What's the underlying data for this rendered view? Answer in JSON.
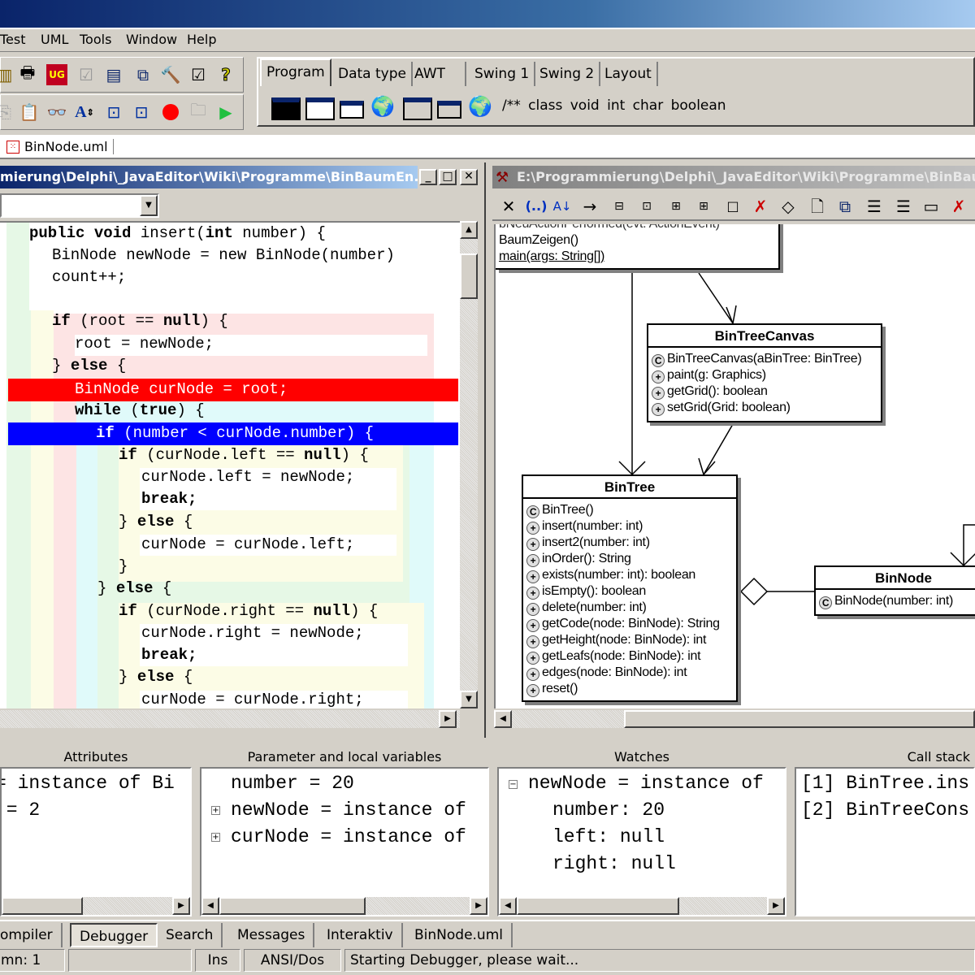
{
  "menu": [
    "Test",
    "UML",
    "Tools",
    "Window",
    "Help"
  ],
  "palette": {
    "tabs": [
      "Program",
      "Data type",
      "AWT",
      "Swing 1",
      "Swing 2",
      "Layout"
    ],
    "active_tab": "Program",
    "keywords": "/** class  void  int  char  boolean"
  },
  "file_tab": "BinNode.uml",
  "editor": {
    "title": "mierung\\Delphi\\_JavaEditor\\Wiki\\Programme\\BinBaumEn...",
    "lines": [
      {
        "text": "public void insert(int number) {"
      },
      {
        "text": "BinNode newNode = new BinNode(number)"
      },
      {
        "text": "count++;"
      },
      {
        "text": ""
      },
      {
        "text": "if (root == null) {"
      },
      {
        "text": "root = newNode;"
      },
      {
        "text": "} else {"
      },
      {
        "text": "BinNode curNode = root;"
      },
      {
        "text": "while (true) {"
      },
      {
        "text": "if (number < curNode.number) {"
      },
      {
        "text": "if (curNode.left == null) {"
      },
      {
        "text": "curNode.left = newNode;"
      },
      {
        "text": "break;"
      },
      {
        "text": "} else {"
      },
      {
        "text": "curNode = curNode.left;"
      },
      {
        "text": "}"
      },
      {
        "text": "} else {"
      },
      {
        "text": "if (curNode.right == null) {"
      },
      {
        "text": "curNode.right = newNode;"
      },
      {
        "text": "break;"
      },
      {
        "text": "} else {"
      },
      {
        "text": "curNode = curNode.right;"
      }
    ],
    "breakpoint_color": "#ff0000",
    "execution_color": "#0000ff"
  },
  "uml": {
    "title": "E:\\Programmierung\\Delphi\\_JavaEditor\\Wiki\\Programme\\BinBaumEn",
    "top_class": {
      "methods": [
        "bNeuActionPerformed(evt: ActionEvent)",
        "BaumZeigen()",
        "main(args: String[])"
      ]
    },
    "classes": [
      {
        "name": "BinTreeCanvas",
        "methods": [
          {
            "kind": "C",
            "sig": "BinTreeCanvas(aBinTree: BinTree)"
          },
          {
            "kind": "+",
            "sig": "paint(g: Graphics)"
          },
          {
            "kind": "+",
            "sig": "getGrid(): boolean"
          },
          {
            "kind": "+",
            "sig": "setGrid(Grid: boolean)"
          }
        ]
      },
      {
        "name": "BinTree",
        "methods": [
          {
            "kind": "C",
            "sig": "BinTree()"
          },
          {
            "kind": "+",
            "sig": "insert(number: int)"
          },
          {
            "kind": "+",
            "sig": "insert2(number: int)"
          },
          {
            "kind": "+",
            "sig": "inOrder(): String"
          },
          {
            "kind": "+",
            "sig": "exists(number: int): boolean"
          },
          {
            "kind": "+",
            "sig": "isEmpty(): boolean"
          },
          {
            "kind": "+",
            "sig": "delete(number: int)"
          },
          {
            "kind": "+",
            "sig": "getCode(node: BinNode): String"
          },
          {
            "kind": "+",
            "sig": "getHeight(node: BinNode): int"
          },
          {
            "kind": "+",
            "sig": "getLeafs(node: BinNode): int"
          },
          {
            "kind": "+",
            "sig": "edges(node: BinNode): int"
          },
          {
            "kind": "+",
            "sig": "reset()"
          }
        ]
      },
      {
        "name": "BinNode",
        "methods": [
          {
            "kind": "C",
            "sig": "BinNode(number: int)"
          }
        ]
      }
    ]
  },
  "debugger": {
    "attributes": {
      "header": "Attributes",
      "lines": [
        "= instance of Bi",
        " = 2"
      ]
    },
    "locals": {
      "header": "Parameter and local variables",
      "lines": [
        "number = 20",
        "newNode = instance of",
        "curNode = instance of"
      ]
    },
    "watches": {
      "header": "Watches",
      "lines": [
        "newNode = instance of",
        "number: 20",
        "left: null",
        "right: null"
      ]
    },
    "callstack": {
      "header": "Call stack",
      "lines": [
        "[1] BinTree.ins",
        "[2] BinTreeCons"
      ]
    }
  },
  "bottom_tabs": [
    "ompiler",
    "Debugger",
    "Search",
    "Messages",
    "Interaktiv",
    "BinNode.uml"
  ],
  "active_bottom_tab": "Debugger",
  "status": {
    "column": "mn:  1",
    "empty": "",
    "mode": "Ins",
    "encoding": "ANSI/Dos",
    "message": "Starting Debugger, please wait..."
  }
}
